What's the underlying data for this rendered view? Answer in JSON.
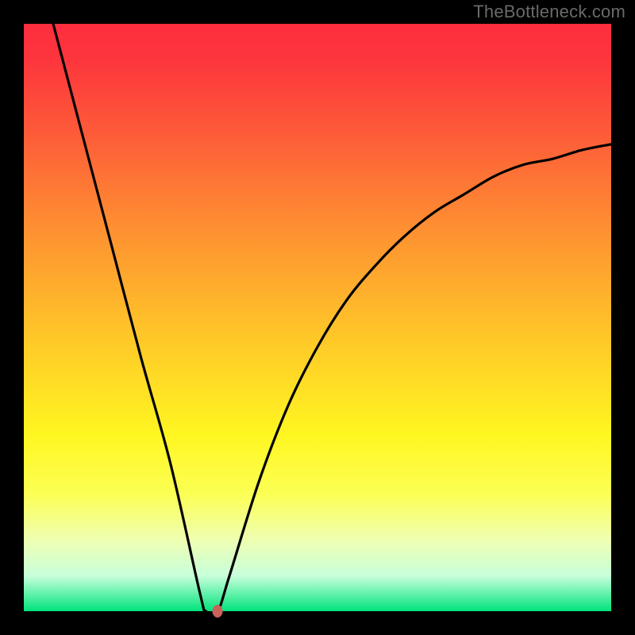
{
  "watermark": "TheBottleneck.com",
  "chart_data": {
    "type": "line",
    "title": "",
    "xlabel": "",
    "ylabel": "",
    "xlim": [
      0,
      100
    ],
    "ylim": [
      0,
      100
    ],
    "grid": false,
    "legend": false,
    "background_gradient": {
      "direction": "vertical",
      "stops": [
        {
          "pos": 0.0,
          "color": "#fd2d3e"
        },
        {
          "pos": 0.18,
          "color": "#fd5939"
        },
        {
          "pos": 0.34,
          "color": "#fe8d32"
        },
        {
          "pos": 0.54,
          "color": "#ffc928"
        },
        {
          "pos": 0.7,
          "color": "#fff621"
        },
        {
          "pos": 0.88,
          "color": "#eeffb3"
        },
        {
          "pos": 1.0,
          "color": "#00e47b"
        }
      ]
    },
    "series": [
      {
        "name": "bottleneck-curve",
        "color": "#000000",
        "x": [
          5,
          10,
          15,
          20,
          25,
          30,
          31,
          33,
          35,
          40,
          45,
          50,
          55,
          60,
          65,
          70,
          75,
          80,
          85,
          90,
          95,
          100
        ],
        "y": [
          100,
          81,
          62,
          43,
          25,
          3,
          0,
          0,
          6,
          22,
          35,
          45,
          53,
          59,
          64,
          68,
          71,
          74,
          76,
          77,
          78.5,
          79.5
        ]
      }
    ],
    "marker": {
      "x": 33,
      "y": 0,
      "color": "#c96259"
    },
    "frame_color": "#000000"
  }
}
